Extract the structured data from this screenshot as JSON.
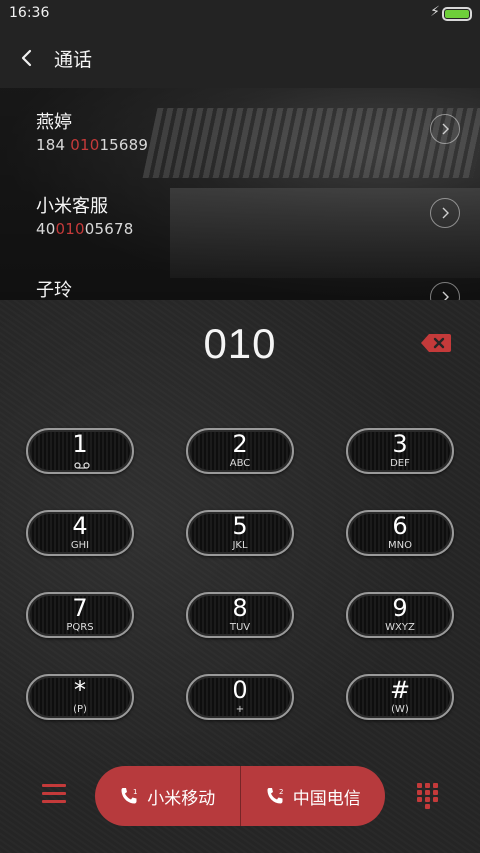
{
  "status": {
    "time": "16:36"
  },
  "header": {
    "title": "通话"
  },
  "results": [
    {
      "name": "燕婷",
      "num_pre": "184 ",
      "num_hl": "010",
      "num_post": "15689"
    },
    {
      "name": "小米客服",
      "num_pre": "40",
      "num_hl": "010",
      "num_post": "05678"
    },
    {
      "name": "子玲",
      "num_pre": "",
      "num_hl": "",
      "num_post": ""
    }
  ],
  "dial": {
    "entry": "010",
    "keys": [
      {
        "digit": "1",
        "sub": ""
      },
      {
        "digit": "2",
        "sub": "ABC"
      },
      {
        "digit": "3",
        "sub": "DEF"
      },
      {
        "digit": "4",
        "sub": "GHI"
      },
      {
        "digit": "5",
        "sub": "JKL"
      },
      {
        "digit": "6",
        "sub": "MNO"
      },
      {
        "digit": "7",
        "sub": "PQRS"
      },
      {
        "digit": "8",
        "sub": "TUV"
      },
      {
        "digit": "9",
        "sub": "WXYZ"
      },
      {
        "digit": "*",
        "sub": "(P)"
      },
      {
        "digit": "0",
        "sub": "+"
      },
      {
        "digit": "#",
        "sub": "(W)"
      }
    ]
  },
  "bottom": {
    "sim1_label": "小米移动",
    "sim1_index": "1",
    "sim2_label": "中国电信",
    "sim2_index": "2"
  },
  "colors": {
    "accent": "#c43a3a",
    "call_bar": "#b73a3d"
  }
}
